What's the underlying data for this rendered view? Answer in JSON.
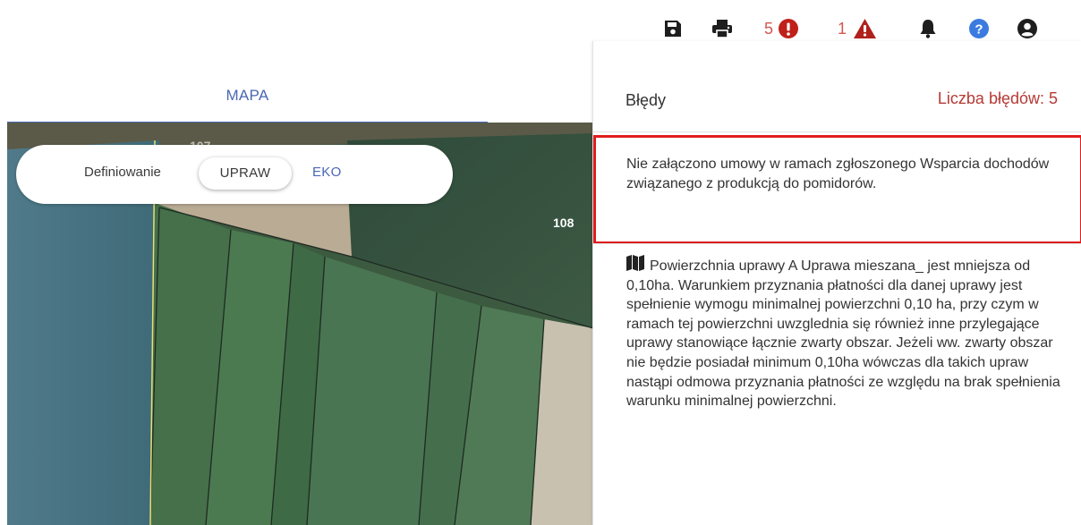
{
  "toolbar": {
    "errors_count": "5",
    "warnings_count": "1",
    "icons": [
      "save-icon",
      "print-icon",
      "error-circle-icon",
      "warning-triangle-icon",
      "bell-icon",
      "help-icon",
      "user-icon"
    ],
    "colors": {
      "error": "#c0201a",
      "warning": "#b0201c",
      "help": "#3b7be0",
      "dark": "#1e1e1e"
    }
  },
  "tabs": {
    "mapa": "MAPA"
  },
  "map": {
    "definition_label": "Definiowanie",
    "upraw_button": "UPRAW",
    "eko_button": "EKO",
    "parcel_labels": {
      "p107": "107",
      "p108": "108"
    }
  },
  "errors_panel": {
    "title": "Błędy",
    "count_label": "Liczba błędów: 5",
    "items": [
      {
        "text": "Nie załączono umowy w ramach zgłoszonego Wsparcia dochodów związanego z produkcją do pomidorów."
      },
      {
        "text": "Powierzchnia uprawy A Uprawa mieszana_ jest mniejsza od 0,10ha. Warunkiem przyznania płatności dla danej uprawy jest spełnienie wymogu minimalnej powierzchni 0,10 ha, przy czym w ramach tej powierzchni uwzglednia się również inne przylegające uprawy stanowiące łącznie zwarty obszar. Jeżeli ww. zwarty obszar nie będzie posiadał minimum 0,10ha wówczas dla takich upraw nastąpi odmowa przyznania płatności ze względu na brak spełnienia warunku minimalnej powierzchni.",
        "icon": "map-icon"
      }
    ]
  }
}
